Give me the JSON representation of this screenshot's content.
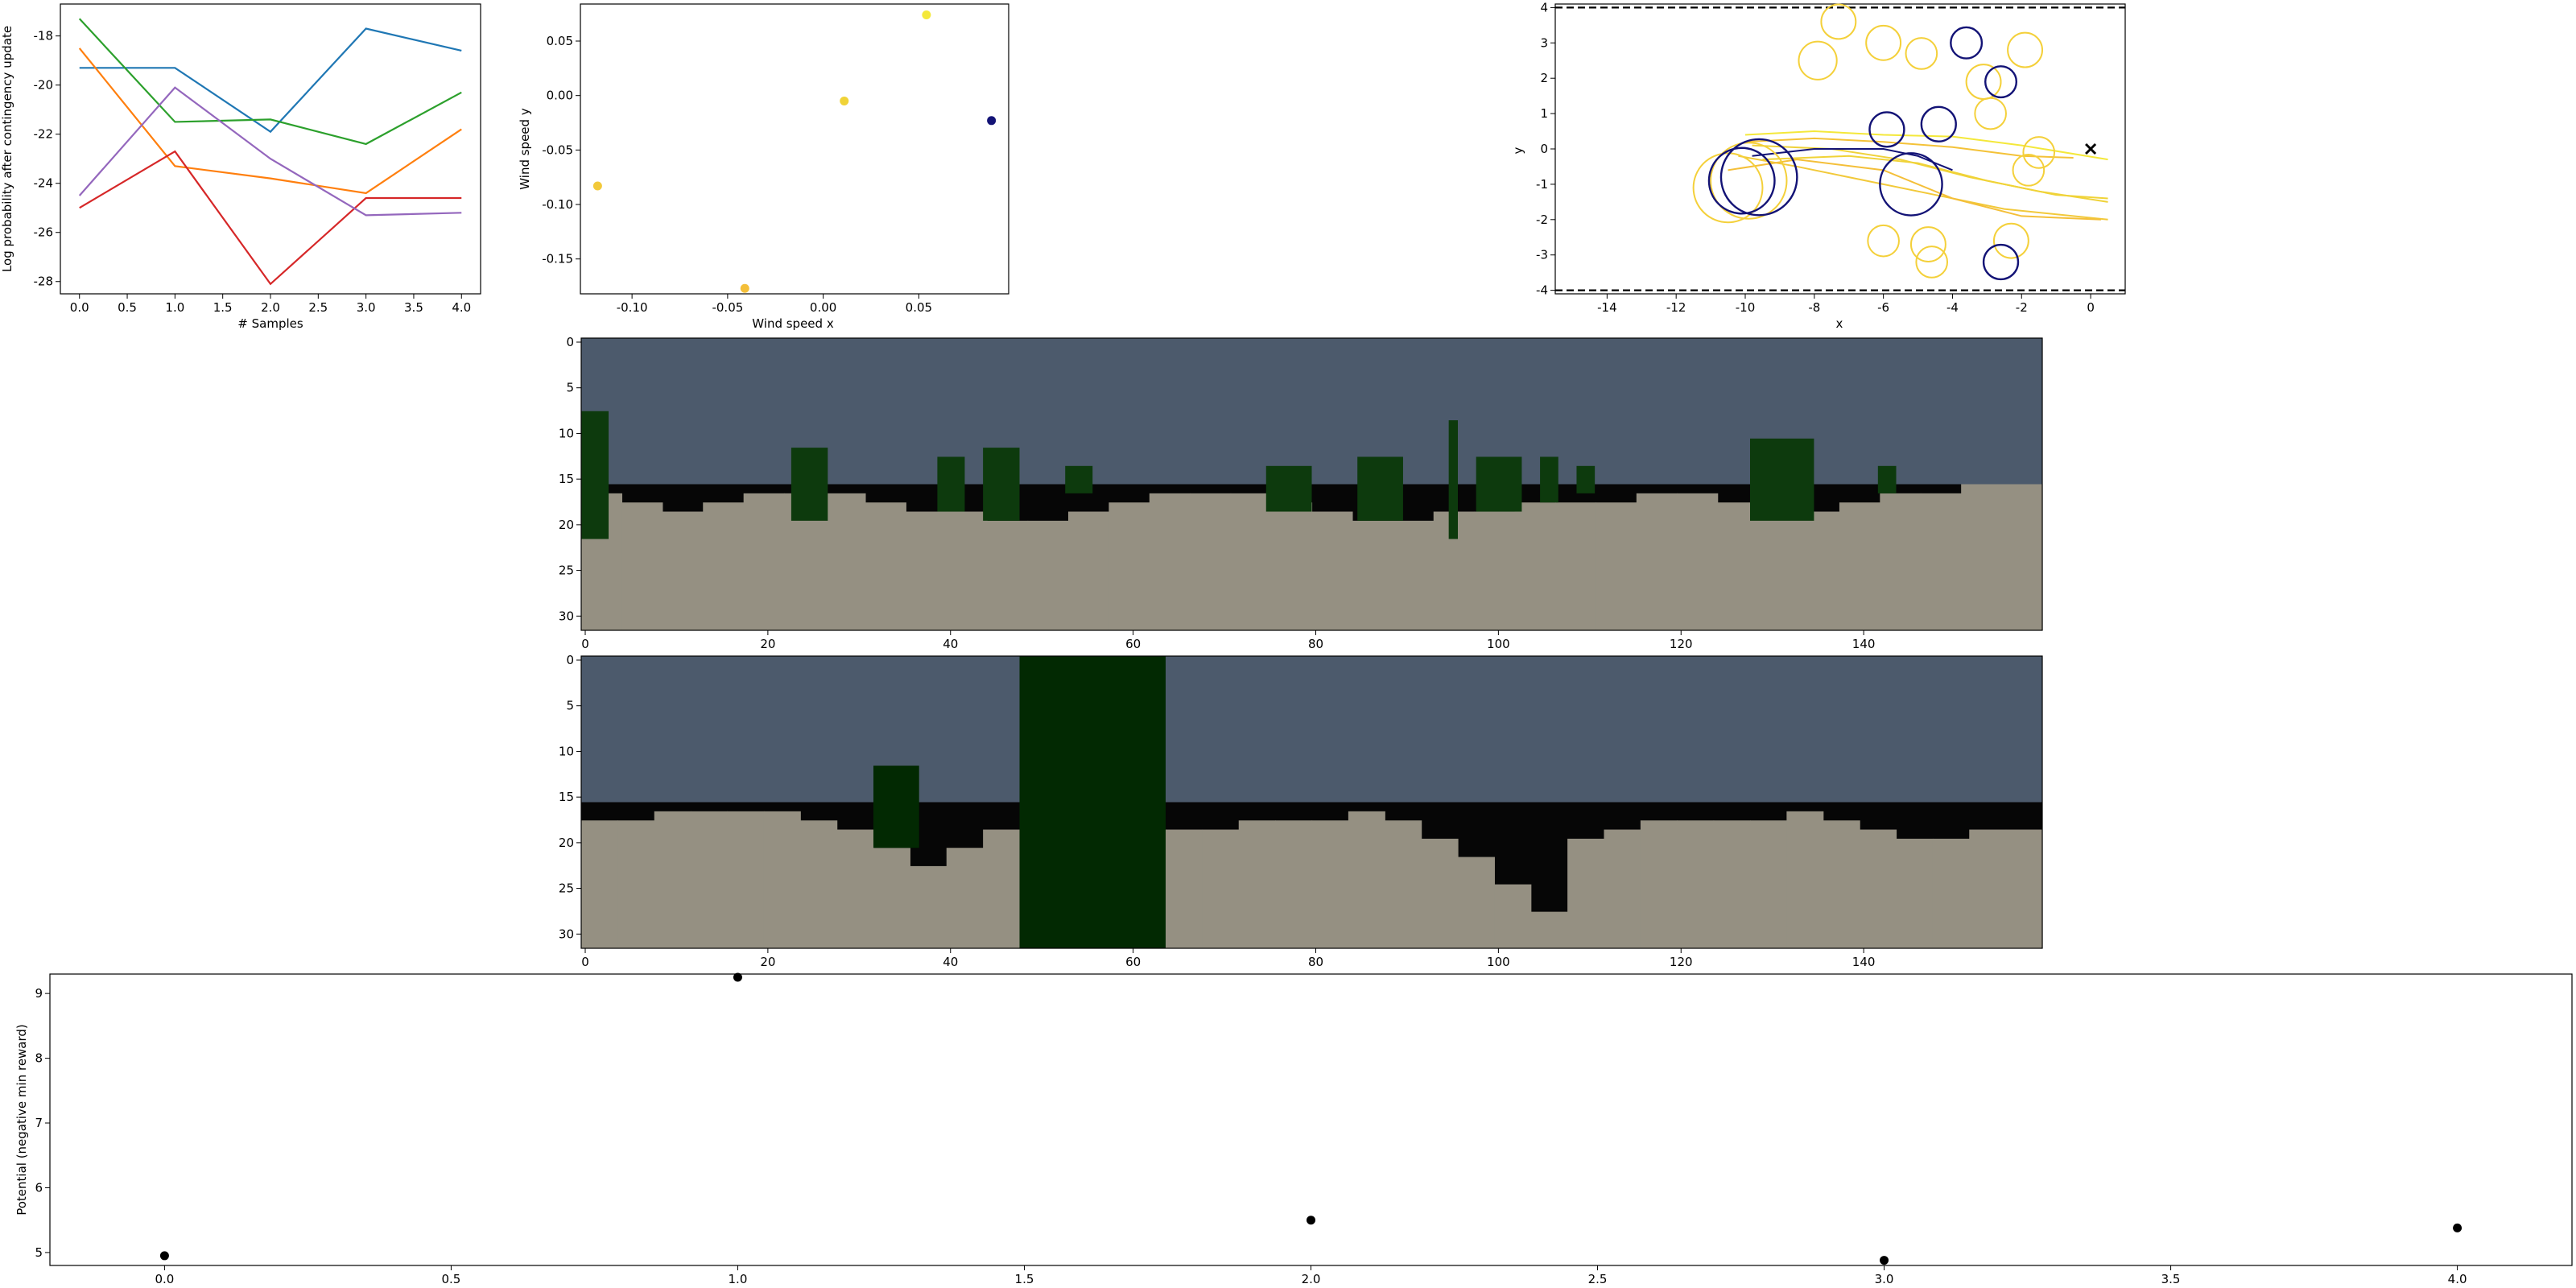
{
  "chart_data": [
    {
      "type": "line",
      "xlabel": "# Samples",
      "ylabel": "Log probability after contingency update",
      "xlim": [
        -0.2,
        4.2
      ],
      "ylim": [
        -28.5,
        -16.7
      ],
      "x": [
        0,
        1,
        2,
        3,
        4
      ],
      "xticks": [
        "0.0",
        "0.5",
        "1.0",
        "1.5",
        "2.0",
        "2.5",
        "3.0",
        "3.5",
        "4.0"
      ],
      "yticks": [
        "-18",
        "-20",
        "-22",
        "-24",
        "-26",
        "-28"
      ],
      "series": [
        {
          "color": "#1f77b4",
          "values": [
            -19.3,
            -19.3,
            -21.9,
            -17.7,
            -18.6
          ]
        },
        {
          "color": "#ff7f0e",
          "values": [
            -18.5,
            -23.3,
            -23.8,
            -24.4,
            -21.8
          ]
        },
        {
          "color": "#2ca02c",
          "values": [
            -17.3,
            -21.5,
            -21.4,
            -22.4,
            -20.3
          ]
        },
        {
          "color": "#d62728",
          "values": [
            -25.0,
            -22.7,
            -28.1,
            -24.6,
            -24.6
          ]
        },
        {
          "color": "#9467bd",
          "values": [
            -24.5,
            -20.1,
            -23.0,
            -25.3,
            -25.2
          ]
        }
      ]
    },
    {
      "type": "scatter",
      "xlabel": "Wind speed x",
      "ylabel": "Wind speed y",
      "xlim": [
        -0.127,
        0.097
      ],
      "ylim": [
        -0.182,
        0.084
      ],
      "xticks": [
        "-0.10",
        "-0.05",
        "0.00",
        "0.05"
      ],
      "yticks": [
        "0.05",
        "0.00",
        "-0.05",
        "-0.10",
        "-0.15"
      ],
      "points": [
        {
          "x": -0.118,
          "y": -0.083,
          "color": "#f2c93a"
        },
        {
          "x": -0.041,
          "y": -0.177,
          "color": "#f4bf39"
        },
        {
          "x": 0.011,
          "y": -0.005,
          "color": "#f0d337"
        },
        {
          "x": 0.054,
          "y": 0.074,
          "color": "#f4e83a"
        },
        {
          "x": 0.088,
          "y": -0.023,
          "color": "#131376"
        }
      ]
    },
    {
      "type": "scatter",
      "xlabel": "x",
      "ylabel": "y",
      "xlim": [
        -15.5,
        1.0
      ],
      "ylim": [
        -4.1,
        4.1
      ],
      "xticks": [
        "-14",
        "-12",
        "-10",
        "-8",
        "-6",
        "-4",
        "-2",
        "0"
      ],
      "yticks": [
        "4",
        "3",
        "2",
        "1",
        "0",
        "-1",
        "-2",
        "-3",
        "-4"
      ],
      "boundary_y": [
        4,
        -4
      ],
      "goal": {
        "x": 0,
        "y": 0,
        "marker": "x"
      },
      "yellow_circles": [
        {
          "x": -7.3,
          "y": 3.6,
          "r": 0.5
        },
        {
          "x": -7.9,
          "y": 2.5,
          "r": 0.55
        },
        {
          "x": -6.0,
          "y": 3.0,
          "r": 0.5
        },
        {
          "x": -4.9,
          "y": 2.7,
          "r": 0.45
        },
        {
          "x": -1.9,
          "y": 2.8,
          "r": 0.5
        },
        {
          "x": -3.1,
          "y": 1.9,
          "r": 0.5
        },
        {
          "x": -2.9,
          "y": 1.0,
          "r": 0.45
        },
        {
          "x": -1.5,
          "y": -0.1,
          "r": 0.45
        },
        {
          "x": -1.8,
          "y": -0.6,
          "r": 0.45
        },
        {
          "x": -2.3,
          "y": -2.6,
          "r": 0.5
        },
        {
          "x": -4.7,
          "y": -2.7,
          "r": 0.5
        },
        {
          "x": -4.6,
          "y": -3.2,
          "r": 0.45
        },
        {
          "x": -6.0,
          "y": -2.6,
          "r": 0.45
        },
        {
          "x": -10.5,
          "y": -1.1,
          "r": 1.0
        },
        {
          "x": -9.9,
          "y": -0.9,
          "r": 1.1
        }
      ],
      "navy_circles": [
        {
          "x": -3.6,
          "y": 3.0,
          "r": 0.45
        },
        {
          "x": -2.6,
          "y": 1.9,
          "r": 0.45
        },
        {
          "x": -5.9,
          "y": 0.55,
          "r": 0.5
        },
        {
          "x": -4.4,
          "y": 0.7,
          "r": 0.5
        },
        {
          "x": -2.6,
          "y": -3.2,
          "r": 0.5
        },
        {
          "x": -9.6,
          "y": -0.8,
          "r": 1.1
        },
        {
          "x": -10.1,
          "y": -0.9,
          "r": 0.95
        },
        {
          "x": -5.2,
          "y": -1.0,
          "r": 0.9
        }
      ]
    },
    {
      "type": "heatmap",
      "xlim": [
        0,
        160
      ],
      "ylim": [
        32,
        0
      ],
      "xticks": [
        "0",
        "20",
        "40",
        "60",
        "80",
        "100",
        "120",
        "140"
      ],
      "yticks": [
        "0",
        "5",
        "10",
        "15",
        "20",
        "25",
        "30"
      ],
      "palette": {
        "sky": "#4c5a6c",
        "dark": "#060606",
        "ground": "#959082",
        "plant": "#0d3a0d"
      },
      "ground_top": [
        17,
        18,
        19,
        18,
        17,
        17,
        17,
        18,
        19,
        19,
        20,
        20,
        19,
        18,
        17,
        17,
        17,
        18,
        19,
        20,
        20,
        19,
        19,
        18,
        18,
        18,
        17,
        17,
        18,
        19,
        19,
        18,
        17,
        17,
        16,
        16
      ],
      "dark_top": 16,
      "plants": [
        {
          "x0": 0,
          "x1": 3,
          "top": 8,
          "bottom": 22
        },
        {
          "x0": 23,
          "x1": 27,
          "top": 12,
          "bottom": 20
        },
        {
          "x0": 39,
          "x1": 42,
          "top": 13,
          "bottom": 19
        },
        {
          "x0": 44,
          "x1": 48,
          "top": 12,
          "bottom": 20
        },
        {
          "x0": 53,
          "x1": 56,
          "top": 14,
          "bottom": 17
        },
        {
          "x0": 75,
          "x1": 80,
          "top": 14,
          "bottom": 19
        },
        {
          "x0": 85,
          "x1": 90,
          "top": 13,
          "bottom": 20
        },
        {
          "x0": 95,
          "x1": 96,
          "top": 9,
          "bottom": 22
        },
        {
          "x0": 98,
          "x1": 103,
          "top": 13,
          "bottom": 19
        },
        {
          "x0": 105,
          "x1": 107,
          "top": 13,
          "bottom": 18
        },
        {
          "x0": 109,
          "x1": 111,
          "top": 14,
          "bottom": 17
        },
        {
          "x0": 128,
          "x1": 135,
          "top": 11,
          "bottom": 20
        },
        {
          "x0": 142,
          "x1": 144,
          "top": 14,
          "bottom": 17
        }
      ]
    },
    {
      "type": "heatmap",
      "xlim": [
        0,
        160
      ],
      "ylim": [
        32,
        0
      ],
      "xticks": [
        "0",
        "20",
        "40",
        "60",
        "80",
        "100",
        "120",
        "140"
      ],
      "yticks": [
        "0",
        "5",
        "10",
        "15",
        "20",
        "25",
        "30"
      ],
      "palette": {
        "sky": "#4c5a6c",
        "dark": "#060606",
        "ground": "#959082",
        "plant": "#022902"
      },
      "ground_top": [
        18,
        18,
        17,
        17,
        17,
        17,
        18,
        19,
        21,
        23,
        21,
        19,
        19,
        19,
        19,
        19,
        19,
        19,
        18,
        18,
        18,
        17,
        18,
        20,
        22,
        25,
        28,
        20,
        19,
        18,
        18,
        18,
        18,
        17,
        18,
        19,
        20,
        20,
        19,
        19
      ],
      "dark_top": 16,
      "plants": [
        {
          "x0": 32,
          "x1": 37,
          "top": 12,
          "bottom": 21
        },
        {
          "x0": 48,
          "x1": 64,
          "top": 0,
          "bottom": 32
        }
      ]
    },
    {
      "type": "scatter",
      "xlabel": "",
      "ylabel": "Potential (negative min reward)",
      "xlim": [
        -0.2,
        4.2
      ],
      "ylim": [
        4.8,
        9.3
      ],
      "xticks": [
        "0.0",
        "0.5",
        "1.0",
        "1.5",
        "2.0",
        "2.5",
        "3.0",
        "3.5",
        "4.0"
      ],
      "yticks": [
        "9",
        "8",
        "7",
        "6",
        "5"
      ],
      "points": [
        {
          "x": 0,
          "y": 4.95
        },
        {
          "x": 1,
          "y": 9.25
        },
        {
          "x": 2,
          "y": 5.5
        },
        {
          "x": 3,
          "y": 4.88
        },
        {
          "x": 4,
          "y": 5.38
        }
      ]
    }
  ]
}
